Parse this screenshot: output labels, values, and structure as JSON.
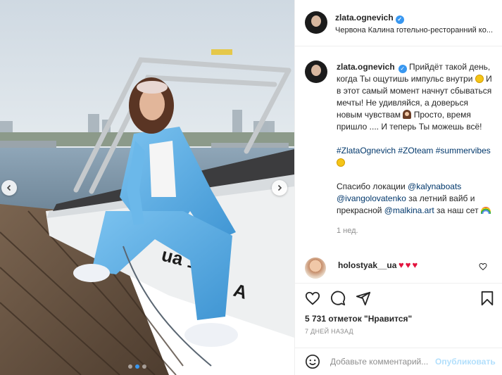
{
  "post": {
    "username": "zlata.ognevich",
    "location": "Червона Калина готельно-ресторанний ко...",
    "caption": {
      "line1": "Прийдёт такой день, когда Ты ощутишь импульс внутри",
      "line2": "И в этот самый момент начнут сбываться мечты! Не удивляйся, а доверься новым чувствам",
      "line3": "Просто, время пришло .... И теперь Ты можешь всё!",
      "hashtags": [
        "#ZlataOgnevich",
        "#ZOteam",
        "#summervibes"
      ],
      "thanks_prefix": "Спасибо локации",
      "mention_1": "@kalynaboats",
      "mention_2": "@ivangolovatenko",
      "thanks_mid": "за летний вайб и прекрасной",
      "mention_3": "@malkina.art",
      "thanks_suffix": "за наш сет"
    },
    "time_ago": "1 нед.",
    "reply": {
      "username": "holostyak__ua",
      "hearts": "♥♥♥"
    },
    "likes_text": "5 731 отметок \"Нравится\"",
    "date": "7 ДНЕЙ НАЗАД",
    "boat_number": "ua 120",
    "boat_letter": "A"
  },
  "comment_box": {
    "placeholder": "Добавьте комментарий...",
    "post_label": "Опубликовать"
  },
  "colors": {
    "link": "#00376b",
    "verified": "#3897f0",
    "heart": "#e3133d",
    "suit": "#5aaee6"
  },
  "icons": [
    "chevron-left-icon",
    "chevron-right-icon",
    "verified-icon",
    "heart-icon",
    "comment-icon",
    "share-icon",
    "bookmark-icon",
    "emoji-icon",
    "sun-emoji",
    "woman-emoji",
    "rainbow-emoji"
  ]
}
